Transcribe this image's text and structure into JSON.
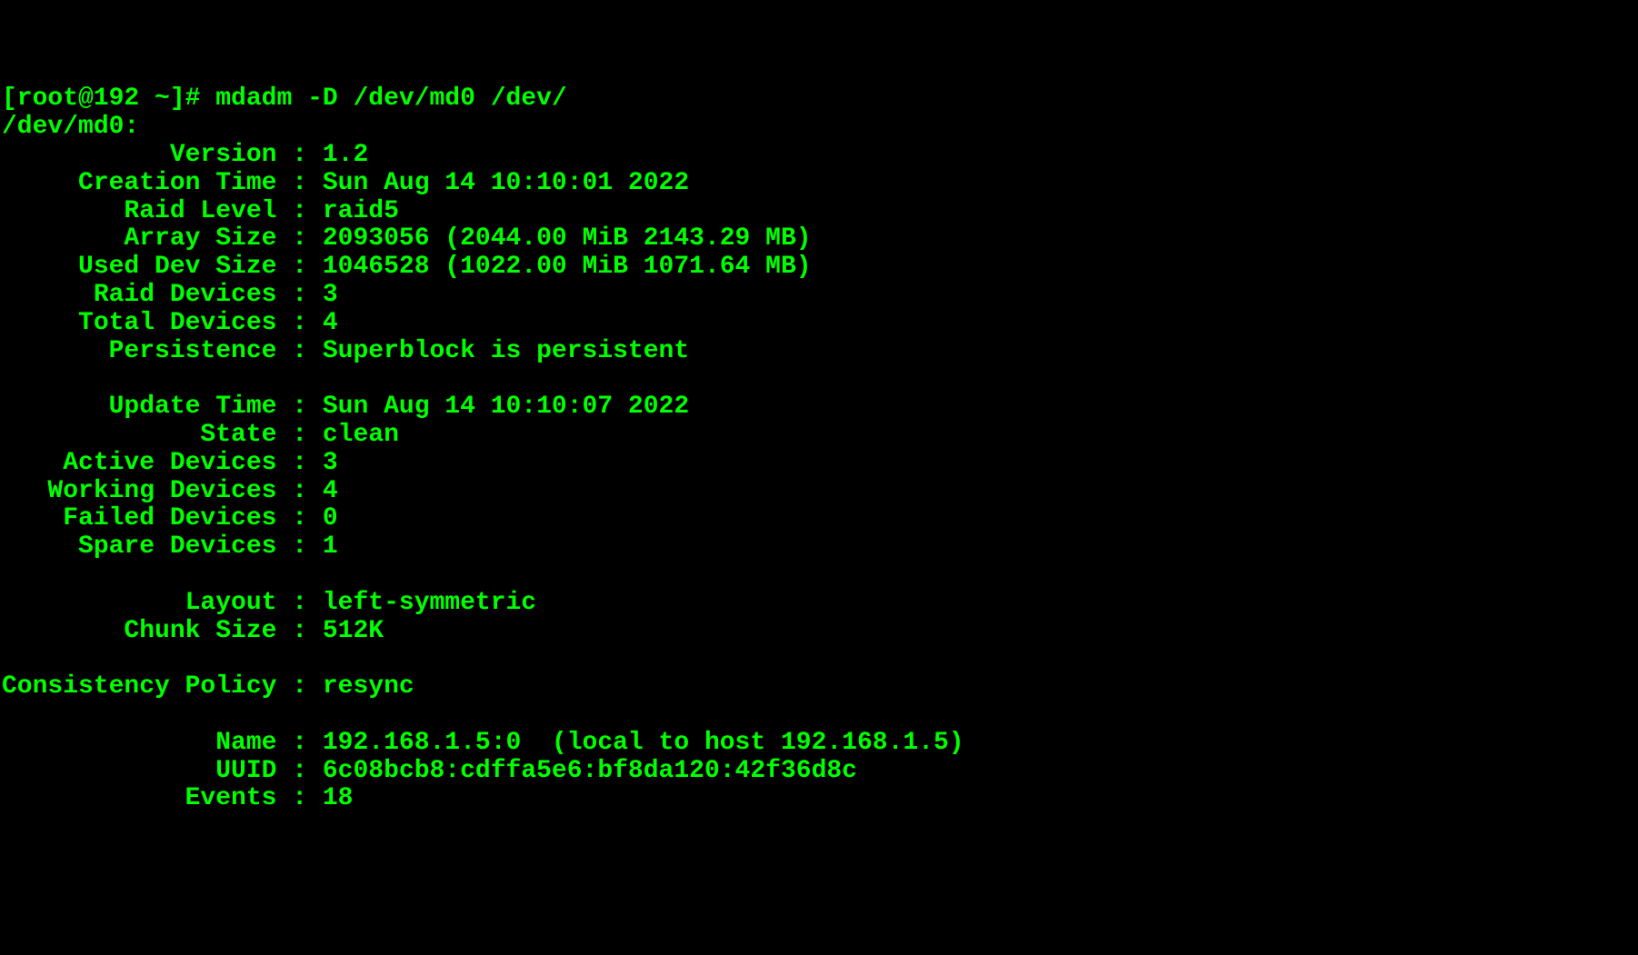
{
  "prompt": "[root@192 ~]# ",
  "command": "mdadm -D /dev/md0 /dev/",
  "device_header": "/dev/md0:",
  "fields": [
    {
      "label": "           Version",
      "value": "1.2"
    },
    {
      "label": "     Creation Time",
      "value": "Sun Aug 14 10:10:01 2022"
    },
    {
      "label": "        Raid Level",
      "value": "raid5"
    },
    {
      "label": "        Array Size",
      "value": "2093056 (2044.00 MiB 2143.29 MB)"
    },
    {
      "label": "     Used Dev Size",
      "value": "1046528 (1022.00 MiB 1071.64 MB)"
    },
    {
      "label": "      Raid Devices",
      "value": "3"
    },
    {
      "label": "     Total Devices",
      "value": "4"
    },
    {
      "label": "       Persistence",
      "value": "Superblock is persistent"
    },
    {
      "label": "",
      "value": ""
    },
    {
      "label": "       Update Time",
      "value": "Sun Aug 14 10:10:07 2022"
    },
    {
      "label": "             State",
      "value": "clean"
    },
    {
      "label": "    Active Devices",
      "value": "3"
    },
    {
      "label": "   Working Devices",
      "value": "4"
    },
    {
      "label": "    Failed Devices",
      "value": "0"
    },
    {
      "label": "     Spare Devices",
      "value": "1"
    },
    {
      "label": "",
      "value": ""
    },
    {
      "label": "            Layout",
      "value": "left-symmetric"
    },
    {
      "label": "        Chunk Size",
      "value": "512K"
    },
    {
      "label": "",
      "value": ""
    },
    {
      "label": "Consistency Policy",
      "value": "resync"
    },
    {
      "label": "",
      "value": ""
    },
    {
      "label": "              Name",
      "value": "192.168.1.5:0  (local to host 192.168.1.5)"
    },
    {
      "label": "              UUID",
      "value": "6c08bcb8:cdffa5e6:bf8da120:42f36d8c"
    },
    {
      "label": "            Events",
      "value": "18"
    }
  ]
}
